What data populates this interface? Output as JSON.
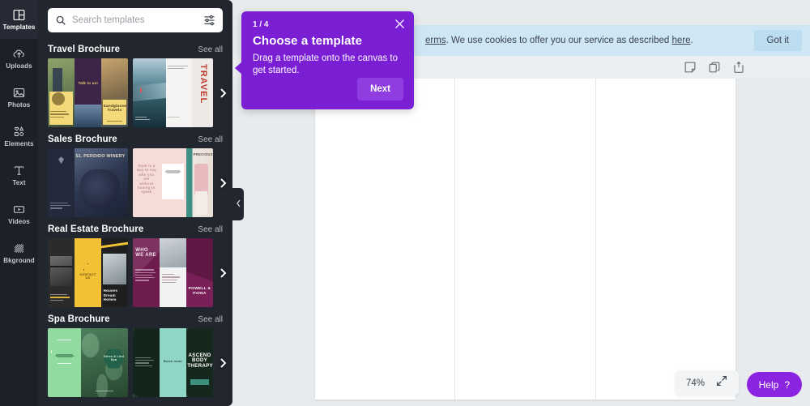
{
  "app": {
    "accent": "#7b1fd4",
    "canvas_bg": "#e8ebed",
    "panel_bg": "#22262f",
    "rail_bg": "#1c2029"
  },
  "rail": {
    "items": [
      {
        "label": "Templates",
        "icon": "templates-icon",
        "active": true
      },
      {
        "label": "Uploads",
        "icon": "upload-cloud-icon",
        "active": false
      },
      {
        "label": "Photos",
        "icon": "photo-icon",
        "active": false
      },
      {
        "label": "Elements",
        "icon": "shapes-icon",
        "active": false
      },
      {
        "label": "Text",
        "icon": "text-icon",
        "active": false
      },
      {
        "label": "Videos",
        "icon": "video-icon",
        "active": false
      },
      {
        "label": "Bkground",
        "icon": "hatch-pattern-icon",
        "active": false
      }
    ]
  },
  "search": {
    "placeholder": "Search templates",
    "value": "",
    "icon": "search-icon",
    "filter_icon": "sliders-icon"
  },
  "panel": {
    "see_all_label": "See all",
    "sections": [
      {
        "title": "Travel Brochure",
        "thumbs": [
          {
            "kind": "travel-a",
            "headline": "Sandglasse Travels",
            "sub": "Talk to us!"
          },
          {
            "kind": "travel-b",
            "headline": "TRAVEL",
            "sub": ""
          }
        ]
      },
      {
        "title": "Sales Brochure",
        "thumbs": [
          {
            "kind": "wine",
            "headline": "EL PERDIDO WINERY",
            "sub": ""
          },
          {
            "kind": "fashion",
            "headline": "PRECIOUS",
            "sub": "Style is a way to say who you are without having to speak"
          }
        ]
      },
      {
        "title": "Real Estate Brochure",
        "thumbs": [
          {
            "kind": "house",
            "headline": "Houses Dream Homes",
            "sub": "CONTACT US"
          },
          {
            "kind": "maroon",
            "headline": "POWELL & FIONA",
            "sub": "WHO WE ARE"
          }
        ]
      },
      {
        "title": "Spa Brochure",
        "thumbs": [
          {
            "kind": "spa-light",
            "headline": "Zahra & Lind Spa",
            "sub": ""
          },
          {
            "kind": "spa-dark",
            "headline": "ASCEND BODY THERAPY",
            "sub": "Book now!"
          }
        ]
      }
    ]
  },
  "cookie": {
    "text_before": "erms",
    "text_middle": ". We use cookies to offer you our service as described ",
    "link_label": "here",
    "text_after": ".",
    "button_label": "Got it"
  },
  "toolbar": {
    "icons": [
      {
        "name": "notes-icon"
      },
      {
        "name": "duplicate-page-icon"
      },
      {
        "name": "add-page-icon"
      }
    ]
  },
  "tooltip": {
    "step": "1 / 4",
    "title": "Choose a template",
    "body": "Drag a template onto the canvas to get started.",
    "next_label": "Next",
    "close_icon": "close-icon"
  },
  "canvas": {
    "folds": 3
  },
  "footer": {
    "zoom_level": "74%",
    "fit_icon": "expand-arrows-icon",
    "help_label": "Help",
    "help_mark": "?"
  },
  "collapse": {
    "icon": "chevron-left-icon"
  },
  "carousel": {
    "next_icon": "chevron-right-icon"
  }
}
